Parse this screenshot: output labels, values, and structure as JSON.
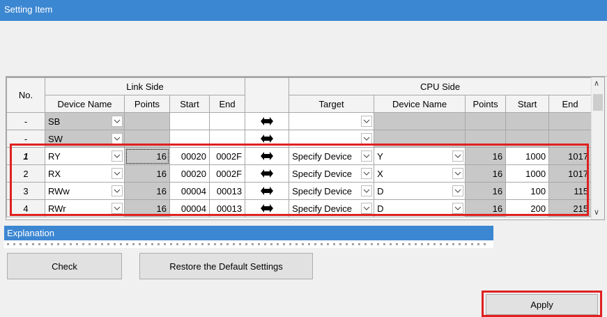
{
  "header": {
    "title": "Setting Item"
  },
  "table": {
    "col_no": "No.",
    "group_link": "Link Side",
    "group_cpu": "CPU Side",
    "link_cols": [
      "Device Name",
      "Points",
      "Start",
      "End"
    ],
    "cpu_cols": [
      "Target",
      "Device Name",
      "Points",
      "Start",
      "End"
    ],
    "rows": [
      {
        "no": "-",
        "link_device": "SB",
        "link_points": "",
        "link_start": "",
        "link_end": "",
        "target": "",
        "cpu_device": "",
        "cpu_points": "",
        "cpu_start": "",
        "cpu_end": ""
      },
      {
        "no": "-",
        "link_device": "SW",
        "link_points": "",
        "link_start": "",
        "link_end": "",
        "target": "",
        "cpu_device": "",
        "cpu_points": "",
        "cpu_start": "",
        "cpu_end": ""
      },
      {
        "no": "1",
        "link_device": "RY",
        "link_points": "16",
        "link_start": "00020",
        "link_end": "0002F",
        "target": "Specify Device",
        "cpu_device": "Y",
        "cpu_points": "16",
        "cpu_start": "1000",
        "cpu_end": "1017"
      },
      {
        "no": "2",
        "link_device": "RX",
        "link_points": "16",
        "link_start": "00020",
        "link_end": "0002F",
        "target": "Specify Device",
        "cpu_device": "X",
        "cpu_points": "16",
        "cpu_start": "1000",
        "cpu_end": "1017"
      },
      {
        "no": "3",
        "link_device": "RWw",
        "link_points": "16",
        "link_start": "00004",
        "link_end": "00013",
        "target": "Specify Device",
        "cpu_device": "D",
        "cpu_points": "16",
        "cpu_start": "100",
        "cpu_end": "115"
      },
      {
        "no": "4",
        "link_device": "RWr",
        "link_points": "16",
        "link_start": "00004",
        "link_end": "00013",
        "target": "Specify Device",
        "cpu_device": "D",
        "cpu_points": "16",
        "cpu_start": "200",
        "cpu_end": "215"
      }
    ]
  },
  "explanation": {
    "title": "Explanation"
  },
  "buttons": {
    "check": "Check",
    "restore": "Restore the Default Settings",
    "apply": "Apply"
  },
  "colors": {
    "accent": "#3c87d2",
    "highlight": "#e02020",
    "gray_cell": "#c8c8c8"
  }
}
